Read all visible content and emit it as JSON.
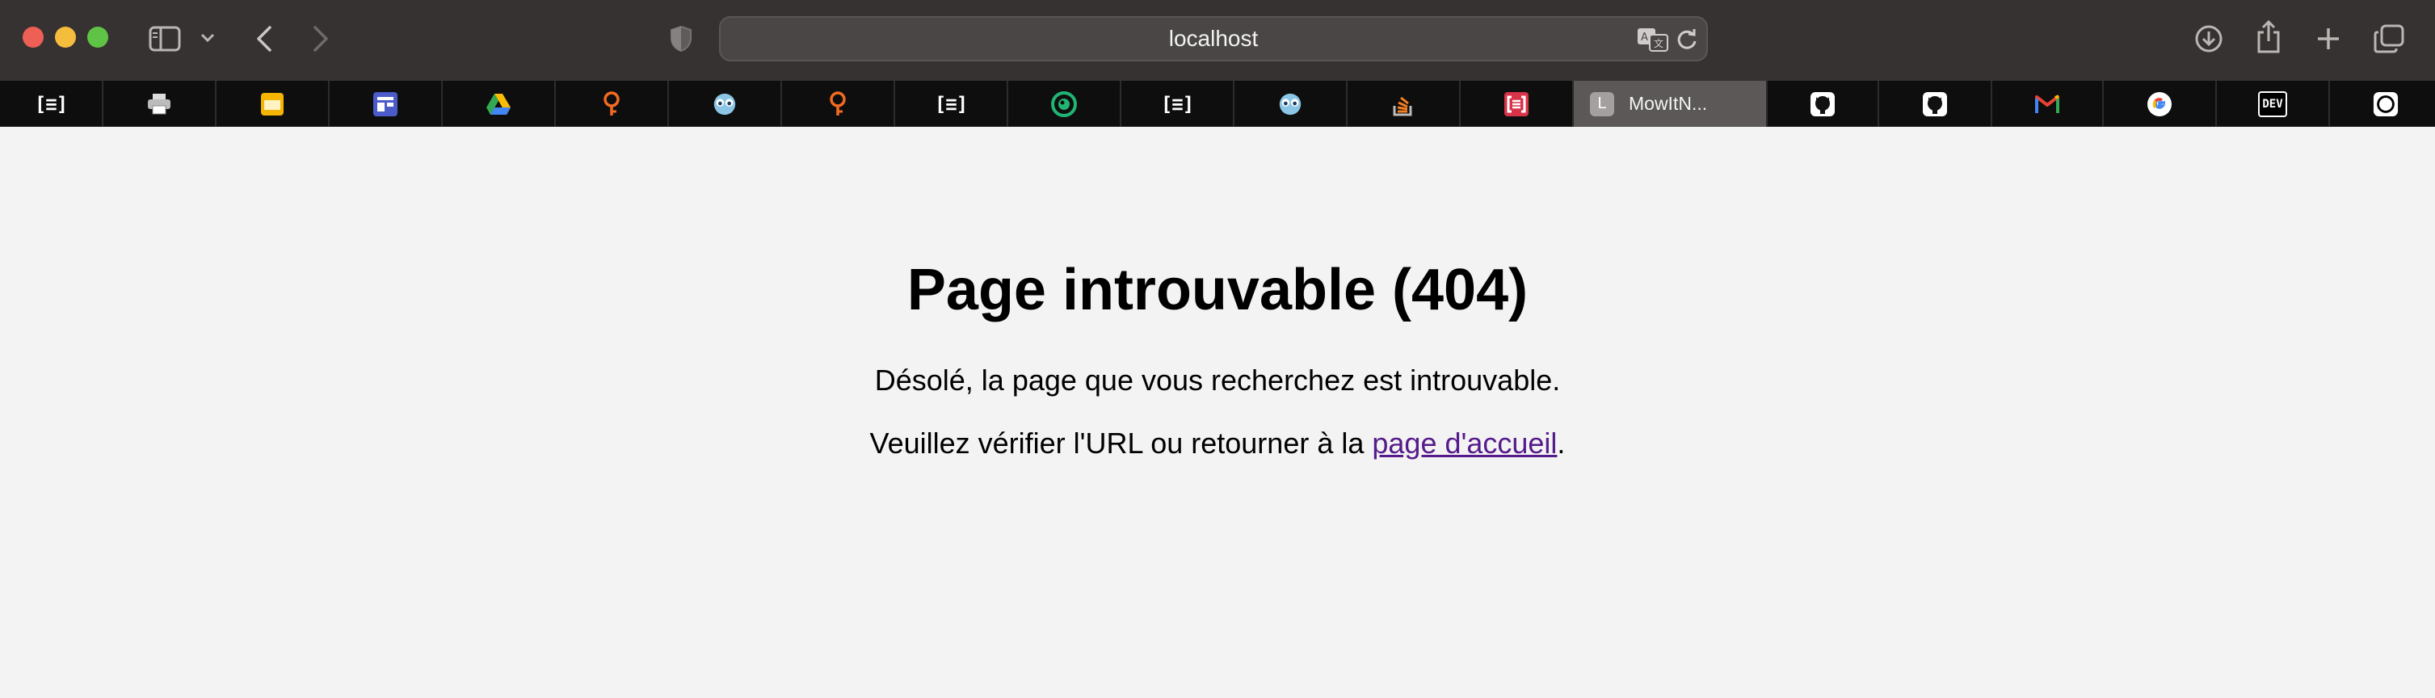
{
  "browser": {
    "address": "localhost",
    "colors": {
      "titlebar": "#363231",
      "tabbar": "#0e0e0e",
      "active_tab": "#5b5857",
      "page_background": "#f3f3f3",
      "visited_link": "#551a8b"
    }
  },
  "tabs": [
    {
      "icon": "bracket-icon",
      "text": "[≡]"
    },
    {
      "icon": "printer-icon"
    },
    {
      "icon": "yellow-window-icon"
    },
    {
      "icon": "layout-icon"
    },
    {
      "icon": "google-drive-icon"
    },
    {
      "icon": "orange-keyhole-icon"
    },
    {
      "icon": "blue-eyes-icon"
    },
    {
      "icon": "orange-keyhole-icon"
    },
    {
      "icon": "bracket-icon",
      "text": "[≡]"
    },
    {
      "icon": "green-circle-icon"
    },
    {
      "icon": "bracket-icon",
      "text": "[≡]"
    },
    {
      "icon": "blue-eyes-icon"
    },
    {
      "icon": "stackoverflow-icon"
    },
    {
      "icon": "red-bracket-icon"
    },
    {
      "icon": "letter-l-icon",
      "text": "L",
      "title": "MowItN...",
      "active": true
    },
    {
      "icon": "github-icon"
    },
    {
      "icon": "github-icon"
    },
    {
      "icon": "gmail-icon"
    },
    {
      "icon": "google-icon"
    },
    {
      "icon": "dev-icon",
      "text": "DEV"
    },
    {
      "icon": "ring-icon"
    }
  ],
  "page": {
    "title": "Page introuvable (404)",
    "message1": "Désolé, la page que vous recherchez est introuvable.",
    "message2_before": "Veuillez vérifier l'URL ou retourner à la ",
    "home_link": "page d'accueil",
    "message2_after": "."
  }
}
